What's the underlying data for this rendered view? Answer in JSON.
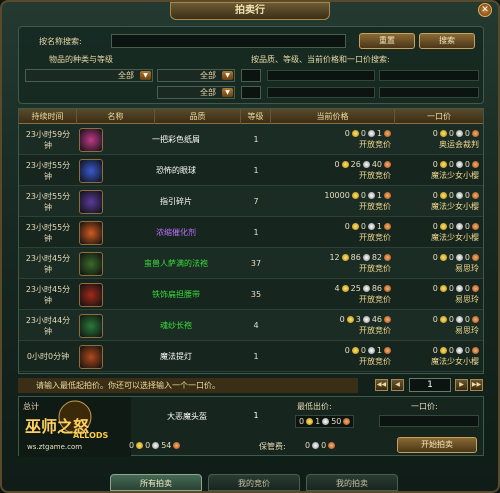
{
  "window": {
    "title": "拍卖行",
    "close_glyph": "✕"
  },
  "search": {
    "name_label": "按名称搜索:",
    "reset_button": "重置",
    "search_button": "搜索",
    "category_label": "物品的种类与等级",
    "filter_label": "按品质、等级、当前价格和一口价搜索:",
    "dropdowns": [
      "全部",
      "全部",
      "全部"
    ]
  },
  "table": {
    "headers": [
      "持续时间",
      "名称",
      "品质",
      "等级",
      "当前价格",
      "一口价"
    ],
    "rows": [
      {
        "time": "23小时59分钟",
        "name": "一把彩色纸屑",
        "name_color": "#ffffff",
        "level": "1",
        "price": [
          "0",
          "0",
          "1"
        ],
        "price_sub": "开放竞价",
        "buy": [
          "0",
          "0",
          "0"
        ],
        "buy_sub": "奥运会裁判",
        "icon_color": "#c03a8a"
      },
      {
        "time": "23小时55分钟",
        "name": "恐怖的眼球",
        "name_color": "#ffffff",
        "level": "1",
        "price": [
          "0",
          "26",
          "40"
        ],
        "price_sub": "开放竞价",
        "buy": [
          "0",
          "0",
          "0"
        ],
        "buy_sub": "魔法少女小樱",
        "icon_color": "#3a5ad0"
      },
      {
        "time": "23小时55分钟",
        "name": "指引碎片",
        "name_color": "#ffffff",
        "level": "7",
        "price": [
          "10000",
          "0",
          "1"
        ],
        "price_sub": "开放竞价",
        "buy": [
          "0",
          "0",
          "0"
        ],
        "buy_sub": "魔法少女小樱",
        "icon_color": "#5a3a9a"
      },
      {
        "time": "23小时55分钟",
        "name": "浓缩催化剂",
        "name_color": "#c070ff",
        "level": "1",
        "price": [
          "0",
          "0",
          "1"
        ],
        "price_sub": "开放竞价",
        "buy": [
          "0",
          "0",
          "0"
        ],
        "buy_sub": "魔法少女小樱",
        "icon_color": "#d05a20"
      },
      {
        "time": "23小时45分钟",
        "name": "蛮兽人萨满的法袍",
        "name_color": "#3adc3a",
        "level": "37",
        "price": [
          "12",
          "86",
          "82"
        ],
        "price_sub": "开放竞价",
        "buy": [
          "0",
          "0",
          "0"
        ],
        "buy_sub": "易思玲",
        "icon_color": "#3a6a2a"
      },
      {
        "time": "23小时45分钟",
        "name": "铁饰扁担腰带",
        "name_color": "#3adc3a",
        "level": "35",
        "price": [
          "4",
          "25",
          "86"
        ],
        "price_sub": "开放竞价",
        "buy": [
          "0",
          "0",
          "0"
        ],
        "buy_sub": "易思玲",
        "icon_color": "#a02a1a"
      },
      {
        "time": "23小时44分钟",
        "name": "魂纱长袍",
        "name_color": "#3adc3a",
        "level": "4",
        "price": [
          "0",
          "3",
          "46"
        ],
        "price_sub": "开放竞价",
        "buy": [
          "0",
          "0",
          "0"
        ],
        "buy_sub": "易思玲",
        "icon_color": "#2a7a3a"
      },
      {
        "time": "0小时0分钟",
        "name": "魔法提灯",
        "name_color": "#ffffff",
        "level": "1",
        "price": [
          "0",
          "0",
          "1"
        ],
        "price_sub": "开放竞价",
        "buy": [
          "0",
          "0",
          "0"
        ],
        "buy_sub": "魔法少女小樱",
        "icon_color": "#b04a1a"
      }
    ]
  },
  "footer": {
    "note": "请输入最低起拍价。你还可以选择输入一个一口价。",
    "page": "1",
    "first": "◀◀",
    "prev": "◀",
    "next": "▶",
    "last": "▶▶"
  },
  "sell": {
    "item_name": "大恶魔头盔",
    "level": "1",
    "min_bid_label": "最低出价:",
    "buyout_label": "一口价:",
    "deposit_label": "保管费:",
    "min_bid": [
      "0",
      "1",
      "50"
    ],
    "deposit": [
      "0",
      "0"
    ],
    "total": [
      "0",
      "0",
      "54"
    ],
    "start_button": "开始拍卖",
    "logo_text": "巫师之怒",
    "logo_sub": "ALLODS",
    "logo_url": "ws.ztgame.com",
    "total_label": "总计"
  },
  "tabs": [
    "所有拍卖",
    "我的竞价",
    "我的拍卖"
  ]
}
